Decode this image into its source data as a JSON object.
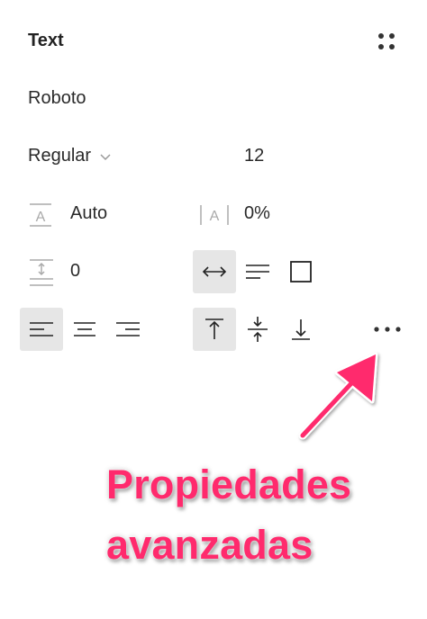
{
  "panel": {
    "title": "Text",
    "font_family": "Roboto",
    "font_weight": "Regular",
    "font_size": "12",
    "line_height": "Auto",
    "letter_spacing": "0%",
    "paragraph_spacing": "0"
  },
  "annotation": {
    "line1": "Propiedades",
    "line2": "avanzadas",
    "color": "#ff2a6d"
  },
  "icons": {
    "options": "four-dots-icon",
    "weight_dropdown": "chevron-down-icon",
    "line_height": "line-height-icon",
    "letter_spacing": "letter-spacing-icon",
    "paragraph_spacing": "paragraph-spacing-icon",
    "auto_width": "auto-width-icon",
    "auto_height": "auto-height-icon",
    "fixed_size": "fixed-size-icon",
    "align_left": "align-left-icon",
    "align_center": "align-center-icon",
    "align_right": "align-right-icon",
    "align_top": "align-top-icon",
    "align_middle": "align-middle-icon",
    "align_bottom": "align-bottom-icon",
    "more": "more-horizontal-icon"
  },
  "state": {
    "selected_resize": "auto-width",
    "selected_horizontal_align": "left",
    "selected_vertical_align": "top"
  }
}
